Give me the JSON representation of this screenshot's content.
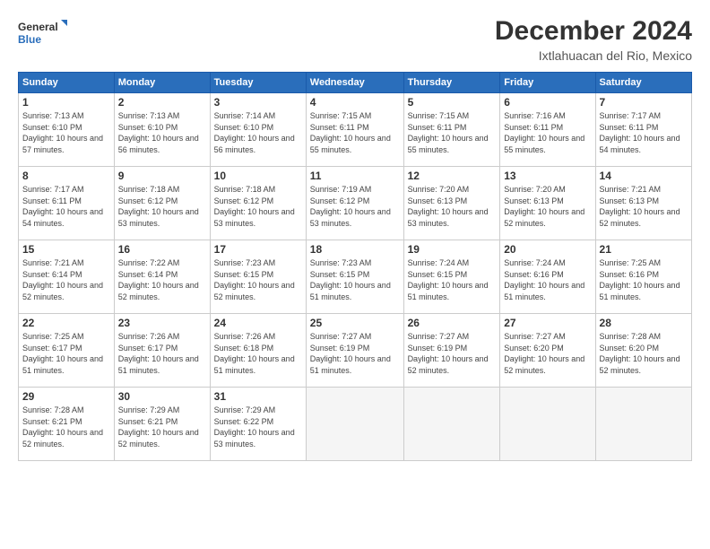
{
  "logo": {
    "line1": "General",
    "line2": "Blue"
  },
  "title": "December 2024",
  "subtitle": "Ixtlahuacan del Rio, Mexico",
  "days_header": [
    "Sunday",
    "Monday",
    "Tuesday",
    "Wednesday",
    "Thursday",
    "Friday",
    "Saturday"
  ],
  "weeks": [
    [
      {
        "day": "1",
        "sunrise": "Sunrise: 7:13 AM",
        "sunset": "Sunset: 6:10 PM",
        "daylight": "Daylight: 10 hours and 57 minutes."
      },
      {
        "day": "2",
        "sunrise": "Sunrise: 7:13 AM",
        "sunset": "Sunset: 6:10 PM",
        "daylight": "Daylight: 10 hours and 56 minutes."
      },
      {
        "day": "3",
        "sunrise": "Sunrise: 7:14 AM",
        "sunset": "Sunset: 6:10 PM",
        "daylight": "Daylight: 10 hours and 56 minutes."
      },
      {
        "day": "4",
        "sunrise": "Sunrise: 7:15 AM",
        "sunset": "Sunset: 6:11 PM",
        "daylight": "Daylight: 10 hours and 55 minutes."
      },
      {
        "day": "5",
        "sunrise": "Sunrise: 7:15 AM",
        "sunset": "Sunset: 6:11 PM",
        "daylight": "Daylight: 10 hours and 55 minutes."
      },
      {
        "day": "6",
        "sunrise": "Sunrise: 7:16 AM",
        "sunset": "Sunset: 6:11 PM",
        "daylight": "Daylight: 10 hours and 55 minutes."
      },
      {
        "day": "7",
        "sunrise": "Sunrise: 7:17 AM",
        "sunset": "Sunset: 6:11 PM",
        "daylight": "Daylight: 10 hours and 54 minutes."
      }
    ],
    [
      {
        "day": "8",
        "sunrise": "Sunrise: 7:17 AM",
        "sunset": "Sunset: 6:11 PM",
        "daylight": "Daylight: 10 hours and 54 minutes."
      },
      {
        "day": "9",
        "sunrise": "Sunrise: 7:18 AM",
        "sunset": "Sunset: 6:12 PM",
        "daylight": "Daylight: 10 hours and 53 minutes."
      },
      {
        "day": "10",
        "sunrise": "Sunrise: 7:18 AM",
        "sunset": "Sunset: 6:12 PM",
        "daylight": "Daylight: 10 hours and 53 minutes."
      },
      {
        "day": "11",
        "sunrise": "Sunrise: 7:19 AM",
        "sunset": "Sunset: 6:12 PM",
        "daylight": "Daylight: 10 hours and 53 minutes."
      },
      {
        "day": "12",
        "sunrise": "Sunrise: 7:20 AM",
        "sunset": "Sunset: 6:13 PM",
        "daylight": "Daylight: 10 hours and 53 minutes."
      },
      {
        "day": "13",
        "sunrise": "Sunrise: 7:20 AM",
        "sunset": "Sunset: 6:13 PM",
        "daylight": "Daylight: 10 hours and 52 minutes."
      },
      {
        "day": "14",
        "sunrise": "Sunrise: 7:21 AM",
        "sunset": "Sunset: 6:13 PM",
        "daylight": "Daylight: 10 hours and 52 minutes."
      }
    ],
    [
      {
        "day": "15",
        "sunrise": "Sunrise: 7:21 AM",
        "sunset": "Sunset: 6:14 PM",
        "daylight": "Daylight: 10 hours and 52 minutes."
      },
      {
        "day": "16",
        "sunrise": "Sunrise: 7:22 AM",
        "sunset": "Sunset: 6:14 PM",
        "daylight": "Daylight: 10 hours and 52 minutes."
      },
      {
        "day": "17",
        "sunrise": "Sunrise: 7:23 AM",
        "sunset": "Sunset: 6:15 PM",
        "daylight": "Daylight: 10 hours and 52 minutes."
      },
      {
        "day": "18",
        "sunrise": "Sunrise: 7:23 AM",
        "sunset": "Sunset: 6:15 PM",
        "daylight": "Daylight: 10 hours and 51 minutes."
      },
      {
        "day": "19",
        "sunrise": "Sunrise: 7:24 AM",
        "sunset": "Sunset: 6:15 PM",
        "daylight": "Daylight: 10 hours and 51 minutes."
      },
      {
        "day": "20",
        "sunrise": "Sunrise: 7:24 AM",
        "sunset": "Sunset: 6:16 PM",
        "daylight": "Daylight: 10 hours and 51 minutes."
      },
      {
        "day": "21",
        "sunrise": "Sunrise: 7:25 AM",
        "sunset": "Sunset: 6:16 PM",
        "daylight": "Daylight: 10 hours and 51 minutes."
      }
    ],
    [
      {
        "day": "22",
        "sunrise": "Sunrise: 7:25 AM",
        "sunset": "Sunset: 6:17 PM",
        "daylight": "Daylight: 10 hours and 51 minutes."
      },
      {
        "day": "23",
        "sunrise": "Sunrise: 7:26 AM",
        "sunset": "Sunset: 6:17 PM",
        "daylight": "Daylight: 10 hours and 51 minutes."
      },
      {
        "day": "24",
        "sunrise": "Sunrise: 7:26 AM",
        "sunset": "Sunset: 6:18 PM",
        "daylight": "Daylight: 10 hours and 51 minutes."
      },
      {
        "day": "25",
        "sunrise": "Sunrise: 7:27 AM",
        "sunset": "Sunset: 6:19 PM",
        "daylight": "Daylight: 10 hours and 51 minutes."
      },
      {
        "day": "26",
        "sunrise": "Sunrise: 7:27 AM",
        "sunset": "Sunset: 6:19 PM",
        "daylight": "Daylight: 10 hours and 52 minutes."
      },
      {
        "day": "27",
        "sunrise": "Sunrise: 7:27 AM",
        "sunset": "Sunset: 6:20 PM",
        "daylight": "Daylight: 10 hours and 52 minutes."
      },
      {
        "day": "28",
        "sunrise": "Sunrise: 7:28 AM",
        "sunset": "Sunset: 6:20 PM",
        "daylight": "Daylight: 10 hours and 52 minutes."
      }
    ],
    [
      {
        "day": "29",
        "sunrise": "Sunrise: 7:28 AM",
        "sunset": "Sunset: 6:21 PM",
        "daylight": "Daylight: 10 hours and 52 minutes."
      },
      {
        "day": "30",
        "sunrise": "Sunrise: 7:29 AM",
        "sunset": "Sunset: 6:21 PM",
        "daylight": "Daylight: 10 hours and 52 minutes."
      },
      {
        "day": "31",
        "sunrise": "Sunrise: 7:29 AM",
        "sunset": "Sunset: 6:22 PM",
        "daylight": "Daylight: 10 hours and 53 minutes."
      },
      null,
      null,
      null,
      null
    ]
  ]
}
